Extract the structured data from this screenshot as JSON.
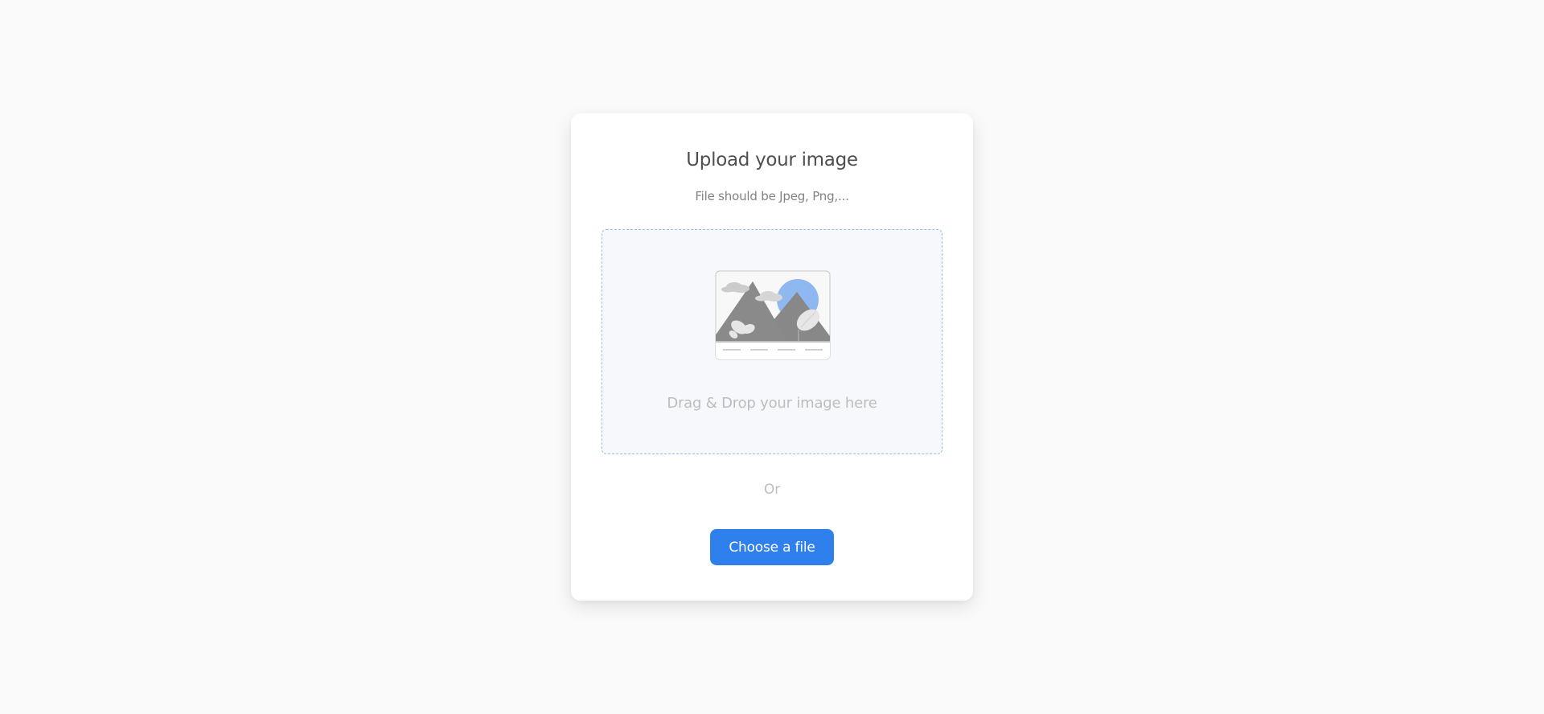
{
  "card": {
    "title": "Upload your image",
    "subtitle": "File should be Jpeg, Png,..."
  },
  "dropzone": {
    "illustration_icon": "mountain-landscape-image-icon",
    "label": "Drag & Drop your image here"
  },
  "divider_text": "Or",
  "choose_button": {
    "label": "Choose a file"
  },
  "colors": {
    "background": "#fafafa",
    "card": "#ffffff",
    "accent": "#2f80ed",
    "dropzone_border": "#97bef4",
    "dropzone_fill": "#f6f8fb",
    "title_text": "#4f4f4f",
    "muted_text": "#bdbdbd"
  }
}
